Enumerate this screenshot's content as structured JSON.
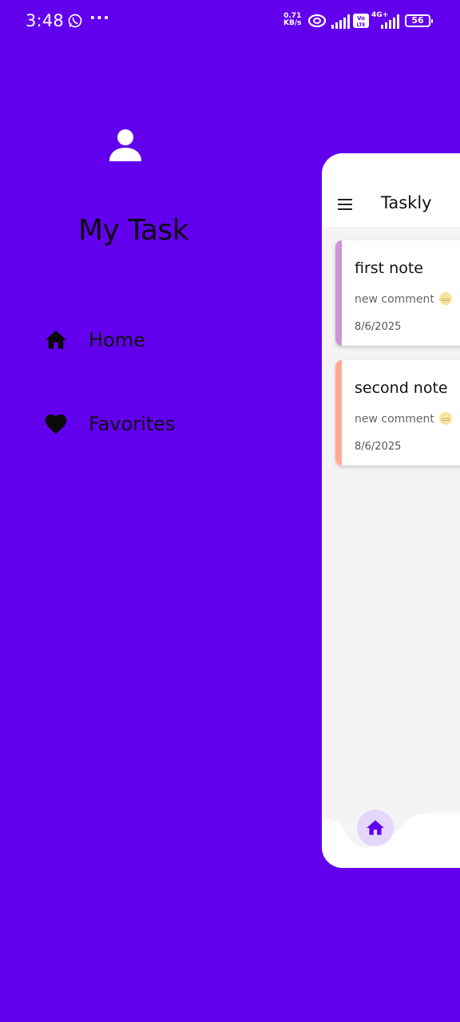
{
  "status_bar": {
    "time": "3:48",
    "net_speed_value": "0.71",
    "net_speed_unit": "KB/s",
    "volte": "Vo LTE",
    "network": "4G+",
    "battery": "56"
  },
  "drawer": {
    "title": "My Task",
    "items": [
      {
        "label": "Home",
        "icon": "home-icon"
      },
      {
        "label": "Favorites",
        "icon": "heart-icon"
      }
    ]
  },
  "app": {
    "title": "Taskly",
    "notes": [
      {
        "title": "first note",
        "comment": "new comment",
        "date": "8/6/2025",
        "accent": "#CE93D8"
      },
      {
        "title": "second note",
        "comment": "new comment",
        "date": "8/6/2025",
        "accent": "#FFAB91"
      }
    ],
    "bottom_nav": {
      "active": "home-icon"
    }
  },
  "colors": {
    "primary": "#6200EE",
    "drawer_text": "#101010",
    "screen_background": "#F4F4F4",
    "active_nav_bg": "#E3D8FB"
  }
}
